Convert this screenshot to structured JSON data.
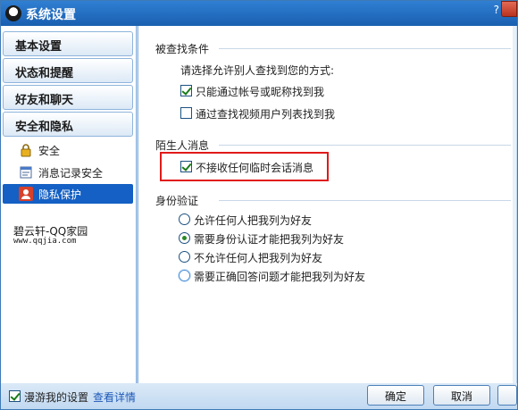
{
  "window": {
    "title": "系统设置",
    "help": "?"
  },
  "sidebar": {
    "categories": [
      {
        "label": "基本设置"
      },
      {
        "label": "状态和提醒"
      },
      {
        "label": "好友和聊天"
      },
      {
        "label": "安全和隐私"
      }
    ],
    "items": [
      {
        "label": "安全",
        "icon": "lock-icon"
      },
      {
        "label": "消息记录安全",
        "icon": "message-record-icon"
      },
      {
        "label": "隐私保护",
        "icon": "privacy-user-icon",
        "selected": true
      }
    ],
    "brand": {
      "name": "碧云轩-QQ家园",
      "url": "www.qqjia.com"
    }
  },
  "content": {
    "search_section": {
      "title": "被查找条件",
      "prompt": "请选择允许别人查找到您的方式:",
      "options": [
        {
          "label": "只能通过帐号或昵称找到我",
          "checked": true
        },
        {
          "label": "通过查找视频用户列表找到我",
          "checked": false
        }
      ]
    },
    "stranger_section": {
      "title": "陌生人消息",
      "options": [
        {
          "label": "不接收任何临时会话消息",
          "checked": true
        }
      ]
    },
    "identity_section": {
      "title": "身份验证",
      "options": [
        {
          "label": "允许任何人把我列为好友",
          "selected": false
        },
        {
          "label": "需要身份认证才能把我列为好友",
          "selected": true
        },
        {
          "label": "不允许任何人把我列为好友",
          "selected": false
        },
        {
          "label": "需要正确回答问题才能把我列为好友",
          "selected": false
        }
      ]
    }
  },
  "footer": {
    "roaming_label": "漫游我的设置",
    "roaming_checked": true,
    "details_link": "查看详情",
    "ok_label": "确定",
    "cancel_label": "取消"
  },
  "colors": {
    "title_bar": "#1a5fb0",
    "selected_item": "#1460c4",
    "highlight_box": "#e01a1a",
    "link": "#1d58b8"
  }
}
